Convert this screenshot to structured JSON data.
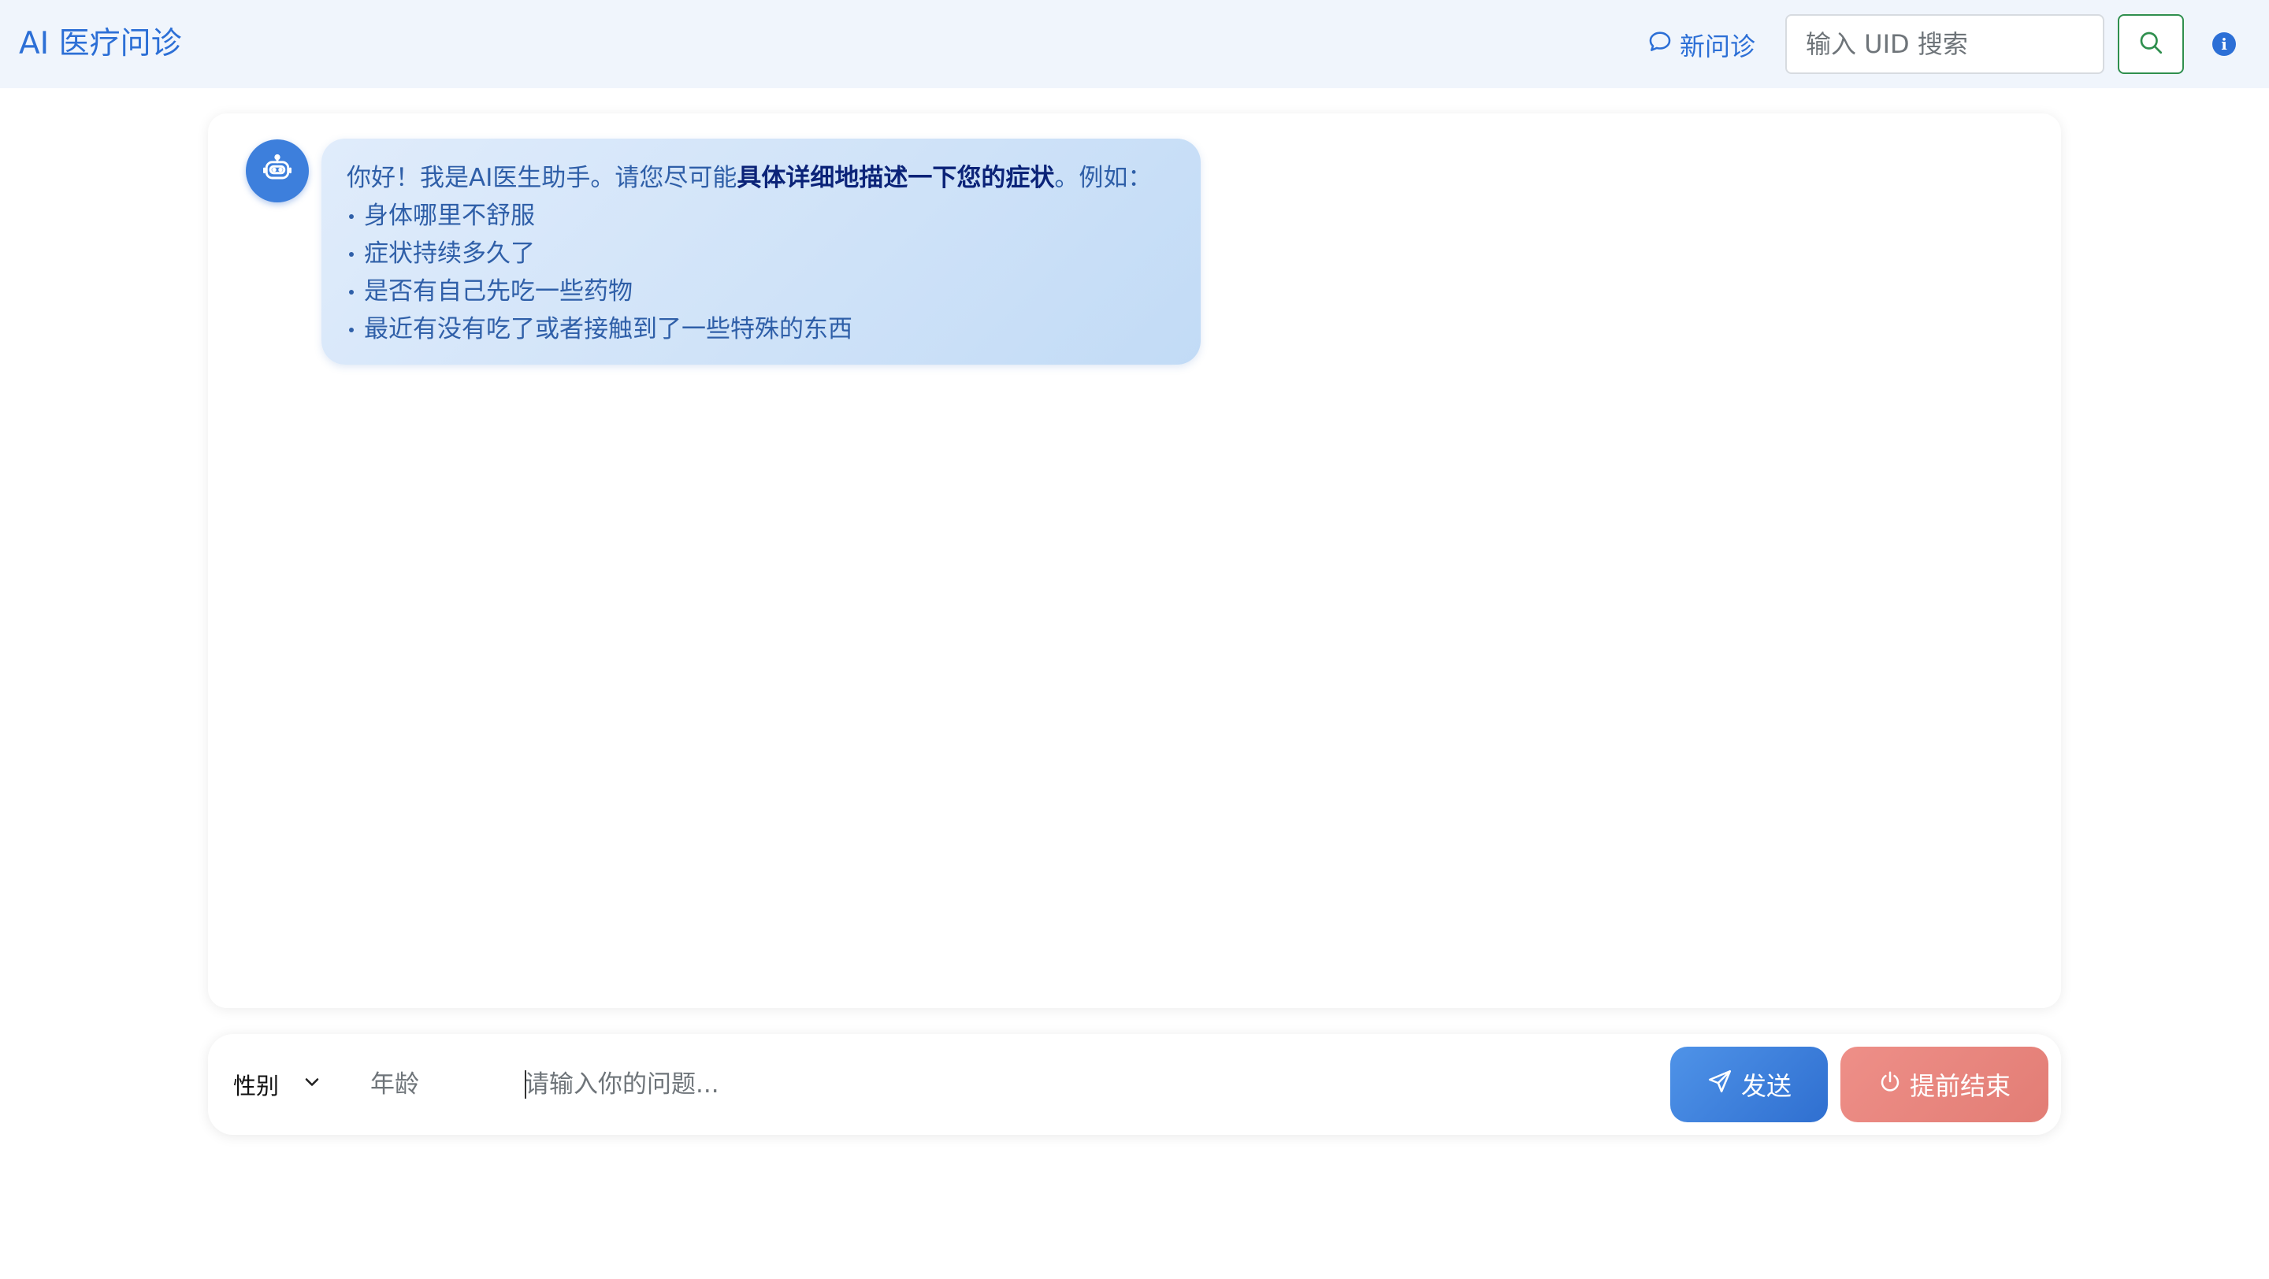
{
  "header": {
    "brand": "AI 医疗问诊",
    "new_consult_label": "新问诊",
    "new_consult_icon": "chat-bubble-icon",
    "search_placeholder": "输入 UID 搜索",
    "search_icon": "search-icon",
    "info_icon": "info-icon"
  },
  "chat": {
    "bot_avatar_icon": "robot-icon",
    "messages": [
      {
        "role": "assistant",
        "intro_before": "你好！我是AI医生助手。请您尽可能",
        "intro_bold": "具体详细地描述一下您的症状",
        "intro_after": "。例如：",
        "bullets": [
          "身体哪里不舒服",
          "症状持续多久了",
          "是否有自己先吃一些药物",
          "最近有没有吃了或者接触到了一些特殊的东西"
        ]
      }
    ]
  },
  "input_bar": {
    "gender_label": "性别",
    "age_placeholder": "年龄",
    "question_placeholder": "请输入你的问题...",
    "send_label": "发送",
    "send_icon": "send-icon",
    "end_label": "提前结束",
    "end_icon": "power-icon"
  },
  "colors": {
    "accent": "#2c6fd6",
    "header_bg": "#f0f5fc",
    "send_button": "#3a7ddb",
    "end_button": "#e8847c",
    "search_button_border": "#2f8f4e"
  }
}
